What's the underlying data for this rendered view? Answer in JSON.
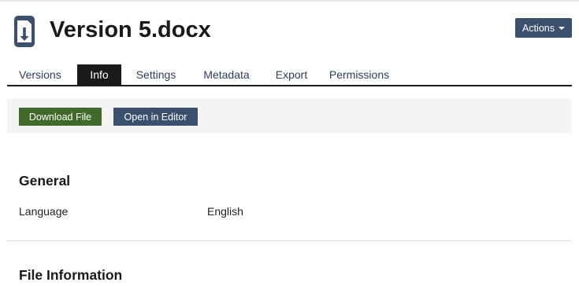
{
  "page": {
    "title": "Version 5.docx"
  },
  "header": {
    "icon": "document-download-icon",
    "actions_label": "Actions"
  },
  "tabs": [
    {
      "label": "Versions",
      "active": false
    },
    {
      "label": "Info",
      "active": true
    },
    {
      "label": "Settings",
      "active": false
    },
    {
      "label": "Metadata",
      "active": false
    },
    {
      "label": "Export",
      "active": false
    },
    {
      "label": "Permissions",
      "active": false
    }
  ],
  "toolbar": {
    "download_label": "Download File",
    "open_editor_label": "Open in Editor"
  },
  "general": {
    "heading": "General",
    "language_label": "Language",
    "language_value": "English"
  },
  "file_information": {
    "heading": "File Information"
  },
  "colors": {
    "nav_dark": "#3b4f6e",
    "download_green": "#3f6a2a",
    "active_tab": "#1a1a1a"
  }
}
